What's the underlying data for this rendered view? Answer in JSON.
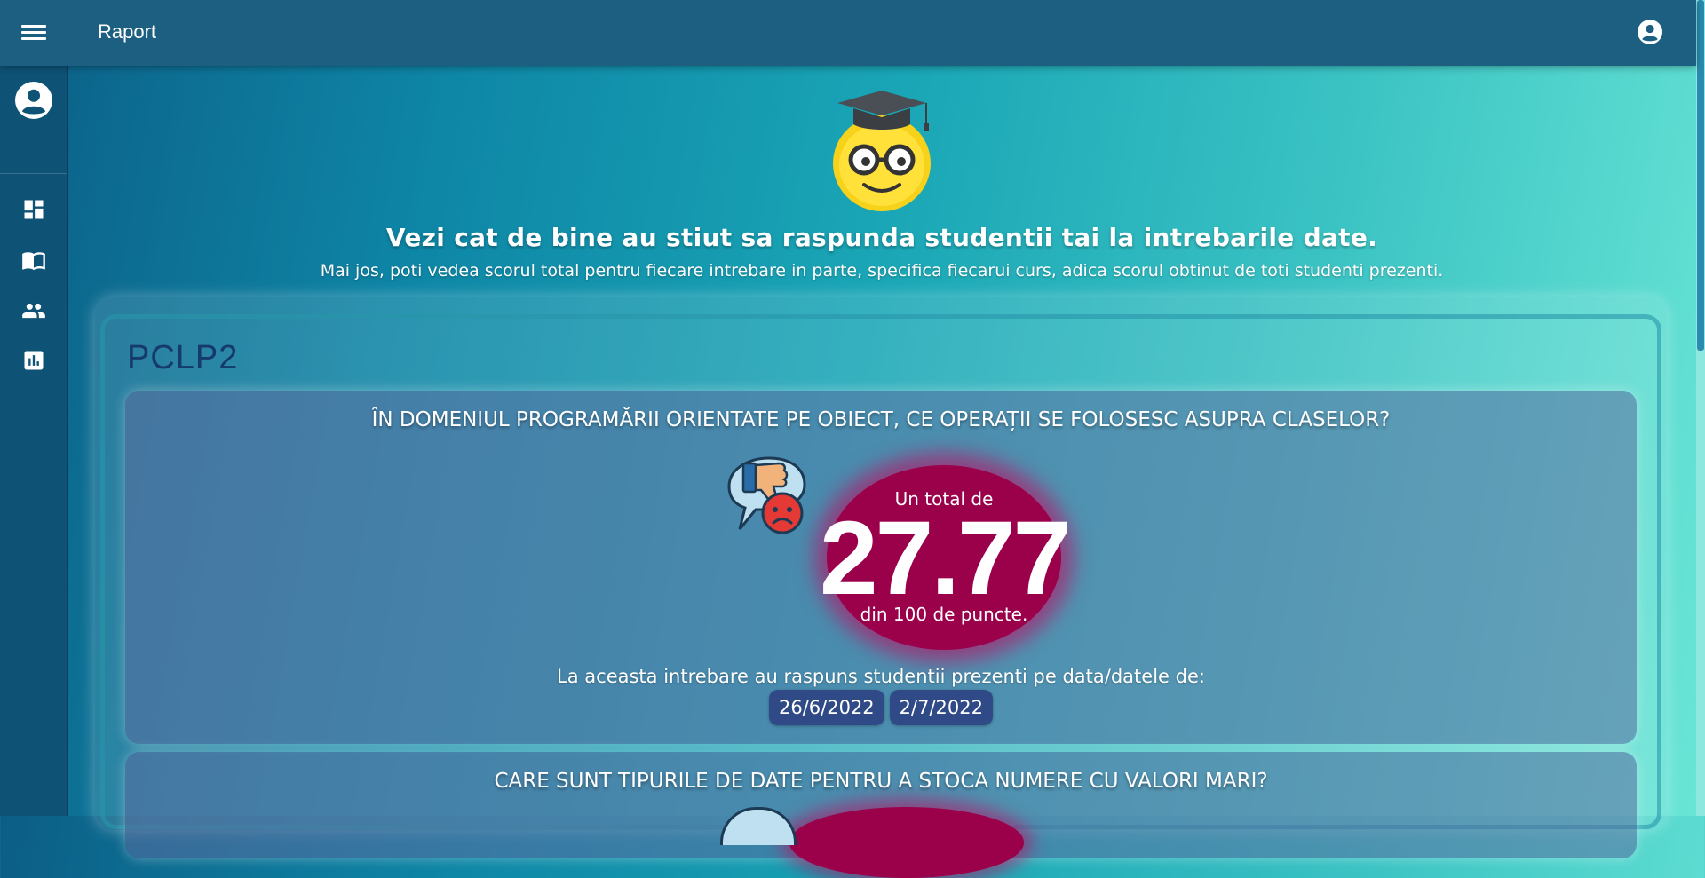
{
  "header": {
    "title": "Raport"
  },
  "sidebar": {
    "items": [
      "dashboard-icon",
      "book-icon",
      "people-icon",
      "chart-icon"
    ]
  },
  "hero": {
    "title": "Vezi cat de bine au stiut sa raspunda studentii tai la intrebarile date.",
    "subtitle": "Mai jos, poti vedea scorul total pentru fiecare intrebare in parte, specifica fiecarui curs, adica scorul obtinut de toti studenti prezenti."
  },
  "course": {
    "title": "PCLP2",
    "questions": [
      {
        "text": "ÎN DOMENIUL PROGRAMĂRII ORIENTATE PE OBIECT, CE OPERAȚII SE FOLOSESC ASUPRA CLASELOR?",
        "score_prefix": "Un total de",
        "score": "27.77",
        "score_suffix": "din 100 de puncte.",
        "answered_label": "La aceasta intrebare au raspuns studentii prezenti pe data/datele de:",
        "dates": [
          "26/6/2022",
          "2/7/2022"
        ]
      },
      {
        "text": "CARE SUNT TIPURILE DE DATE PENTRU A STOCA NUMERE CU VALORI MARI?"
      }
    ]
  },
  "colors": {
    "header": "#1d5f80",
    "sidebar": "#0e5276",
    "score_bubble": "#9b004a",
    "course_title": "#153a6e"
  }
}
